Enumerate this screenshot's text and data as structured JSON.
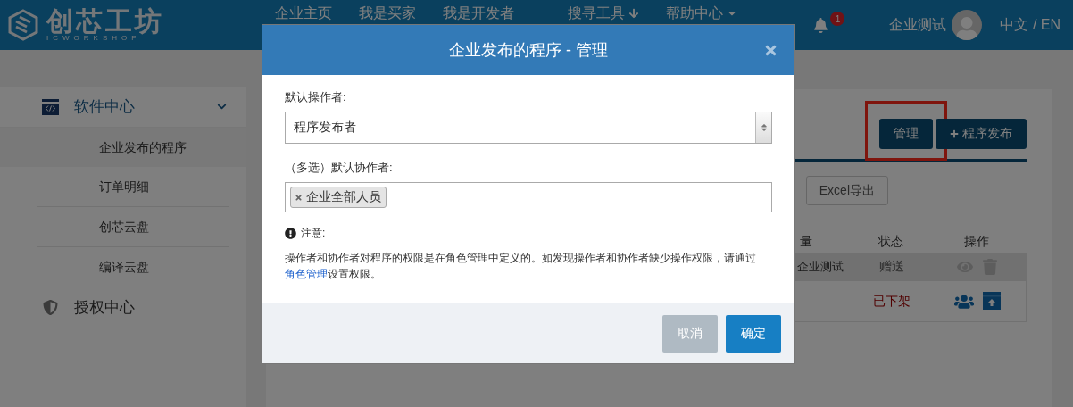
{
  "header": {
    "logo": {
      "name": "创芯工坊",
      "subtitle": "ICWORKSHOP"
    },
    "nav": [
      {
        "label": "企业主页",
        "kind": "plain"
      },
      {
        "label": "我是买家",
        "kind": "plain"
      },
      {
        "label": "我是开发者",
        "kind": "plain"
      },
      {
        "label": "搜寻工具",
        "kind": "download"
      },
      {
        "label": "帮助中心",
        "kind": "dropdown"
      }
    ],
    "notifications": "1",
    "user": "企业测试",
    "language": "中文 / EN"
  },
  "sidebar": {
    "sections": [
      {
        "label": "软件中心",
        "expanded": true,
        "children": [
          {
            "label": "企业发布的程序",
            "selected": true
          },
          {
            "label": "订单明细",
            "selected": false
          },
          {
            "label": "创芯云盘",
            "selected": false
          },
          {
            "label": "编译云盘",
            "selected": false
          }
        ]
      },
      {
        "label": "授权中心",
        "expanded": false
      }
    ]
  },
  "content": {
    "toolbar": [
      {
        "label": "管理",
        "kind": "plain",
        "highlighted": true
      },
      {
        "label": "程序发布",
        "kind": "add",
        "highlighted": false
      }
    ],
    "export_button": "Excel导出",
    "table": {
      "columns": [
        "量",
        "状态",
        "操作"
      ],
      "rows": [
        {
          "kind": "on-sale",
          "publisher": "企业测试",
          "status": "赠送",
          "selected": true,
          "actions": [
            {
              "kind": "view"
            },
            {
              "kind": "delete"
            }
          ]
        },
        {
          "kind": "delisted",
          "status": "已下架",
          "selected": false,
          "actions": [
            {
              "kind": "members"
            },
            {
              "kind": "publish"
            }
          ]
        }
      ]
    }
  },
  "modal": {
    "title": "企业发布的程序 - 管理",
    "operator": {
      "label": "默认操作者:",
      "value": "程序发布者"
    },
    "collaborators": {
      "label": "（多选）默认协作者:",
      "tags": [
        "企业全部人员"
      ]
    },
    "note": {
      "title": "注意:",
      "text": "操作者和协作者对程序的权限是在角色管理中定义的。如发现操作者和协作者缺少操作权限，请通过",
      "link": "角色管理",
      "after": "设置权限。"
    },
    "buttons": [
      {
        "label": "取消",
        "kind": "secondary"
      },
      {
        "label": "确定",
        "kind": "primary"
      }
    ]
  }
}
